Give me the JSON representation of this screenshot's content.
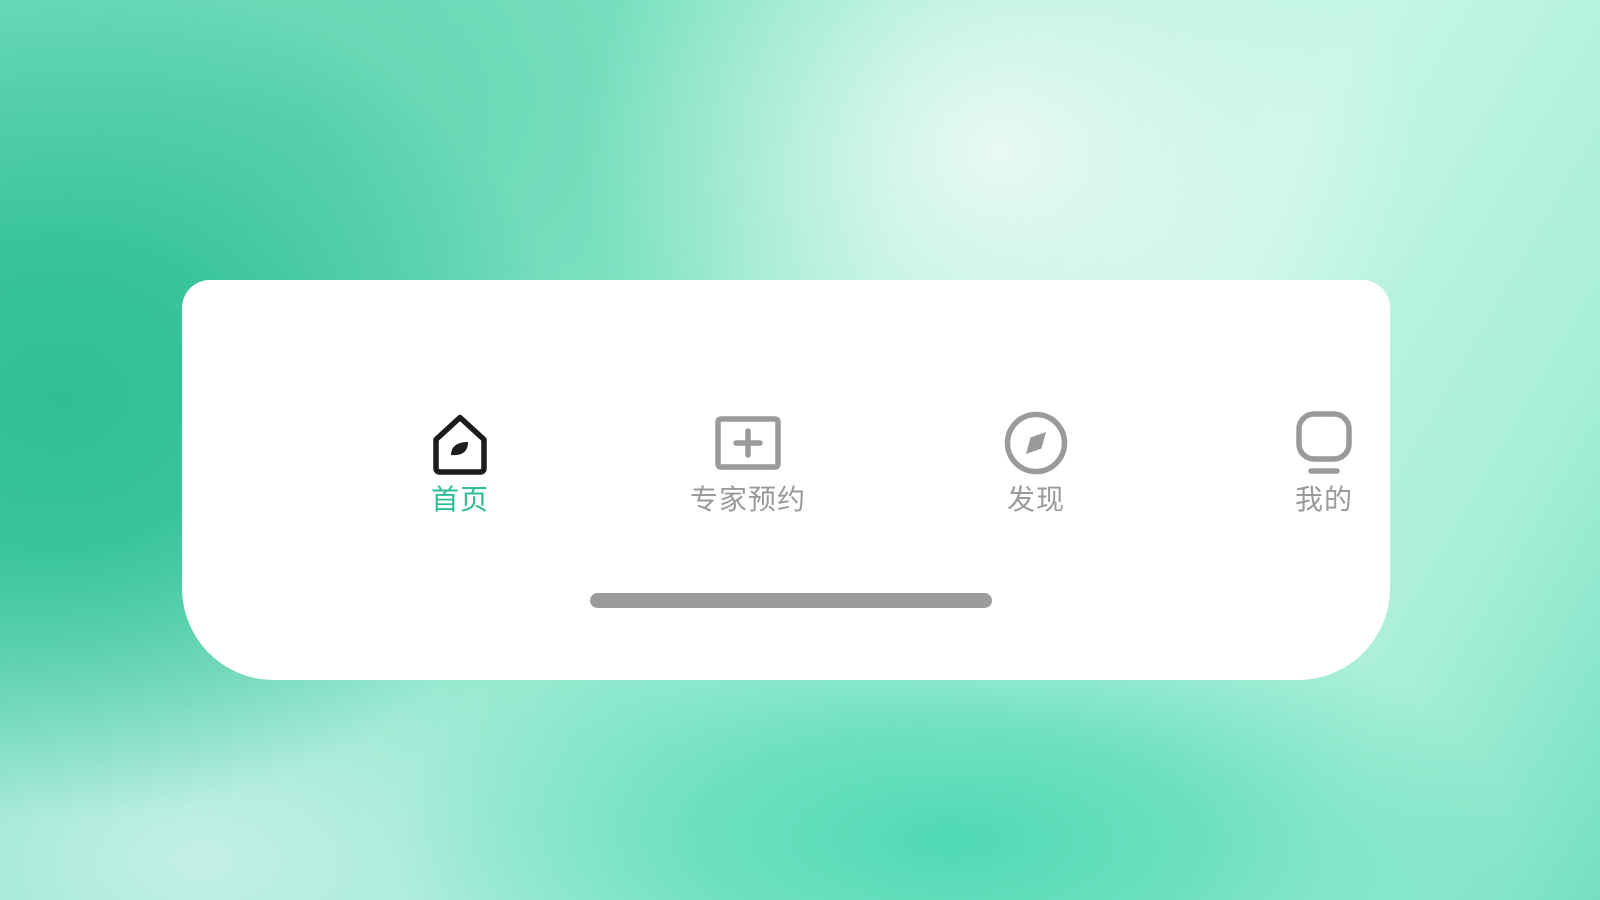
{
  "tabbar": {
    "items": [
      {
        "label": "首页",
        "icon": "home-leaf-icon",
        "active": true
      },
      {
        "label": "专家预约",
        "icon": "add-appointment-icon",
        "active": false
      },
      {
        "label": "发现",
        "icon": "compass-icon",
        "active": false
      },
      {
        "label": "我的",
        "icon": "profile-icon",
        "active": false
      }
    ]
  },
  "colors": {
    "active_label": "#2cbf95",
    "inactive": "#9a9a9a",
    "active_icon": "#1c1c1c",
    "card": "#ffffff",
    "home_indicator": "#9b9b9b"
  }
}
